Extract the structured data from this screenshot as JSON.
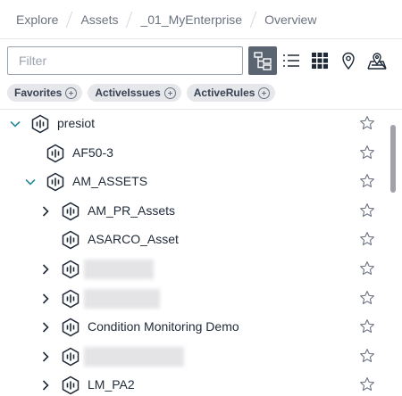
{
  "breadcrumb": {
    "items": [
      "Explore",
      "Assets",
      "_01_MyEnterprise",
      "Overview"
    ]
  },
  "filter": {
    "placeholder": "Filter",
    "value": ""
  },
  "toolbar": {
    "views": [
      {
        "name": "tree-view",
        "icon": "tree-view-icon",
        "active": true
      },
      {
        "name": "list-view",
        "icon": "list-view-icon",
        "active": false
      },
      {
        "name": "grid-view",
        "icon": "grid-view-icon",
        "active": false
      },
      {
        "name": "map-view",
        "icon": "map-pin-icon",
        "active": false
      },
      {
        "name": "map-location-view",
        "icon": "map-location-icon",
        "active": false
      }
    ]
  },
  "chips": [
    {
      "label": "Favorites"
    },
    {
      "label": "ActiveIssues"
    },
    {
      "label": "ActiveRules"
    }
  ],
  "tree": {
    "rows": [
      {
        "label": "presiot",
        "level": 0,
        "expander": "expanded",
        "redacted": false
      },
      {
        "label": "AF50-3",
        "level": 1,
        "expander": "none",
        "redacted": false
      },
      {
        "label": "AM_ASSETS",
        "level": 1,
        "expander": "expanded",
        "redacted": false
      },
      {
        "label": "AM_PR_Assets",
        "level": 2,
        "expander": "collapsed",
        "redacted": false
      },
      {
        "label": "ASARCO_Asset",
        "level": 2,
        "expander": "none",
        "redacted": false
      },
      {
        "label": "",
        "level": 2,
        "expander": "collapsed",
        "redacted": true
      },
      {
        "label": "",
        "level": 2,
        "expander": "collapsed",
        "redacted": true
      },
      {
        "label": "Condition Monitoring Demo",
        "level": 2,
        "expander": "collapsed",
        "redacted": false
      },
      {
        "label": "",
        "level": 2,
        "expander": "collapsed",
        "redacted": true
      },
      {
        "label": "LM_PA2",
        "level": 2,
        "expander": "collapsed",
        "redacted": false
      }
    ]
  },
  "colors": {
    "accent_teal": "#2c8c9a",
    "active_button": "#5b6572",
    "chip_bg": "#e5e7eb",
    "icon_dark": "#1f2937",
    "star_outline": "#6b7280"
  }
}
